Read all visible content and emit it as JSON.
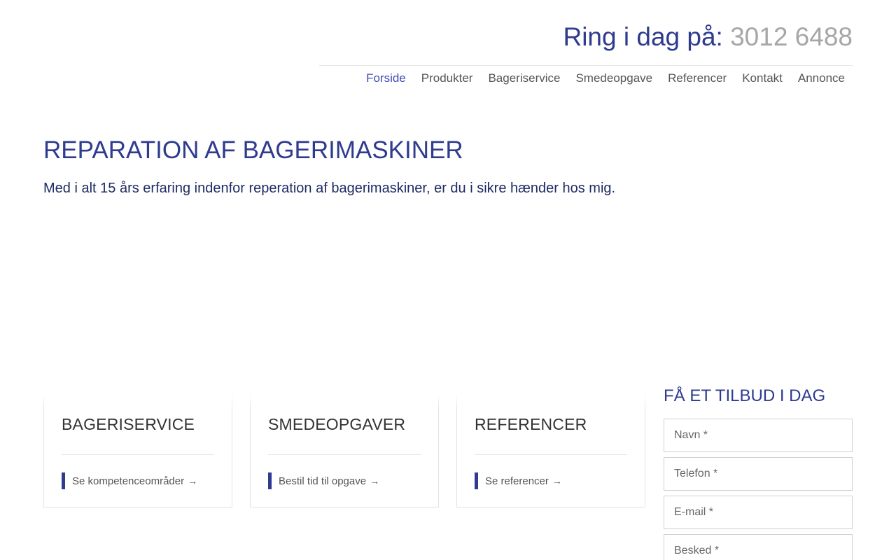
{
  "header": {
    "phone_label": "Ring i dag på:",
    "phone_number": "3012 6488"
  },
  "nav": {
    "items": [
      {
        "label": "Forside",
        "active": true
      },
      {
        "label": "Produkter",
        "active": false
      },
      {
        "label": "Bageriservice",
        "active": false
      },
      {
        "label": "Smedeopgave",
        "active": false
      },
      {
        "label": "Referencer",
        "active": false
      },
      {
        "label": "Kontakt",
        "active": false
      },
      {
        "label": "Annonce",
        "active": false
      }
    ]
  },
  "hero": {
    "title": "REPARATION AF BAGERIMASKINER",
    "subtitle": "Med i alt 15 års erfaring indenfor reperation af bagerimaskiner, er du i sikre hænder hos mig."
  },
  "cards": [
    {
      "title": "BAGERISERVICE",
      "link": "Se kompetenceområder",
      "arrow": "→"
    },
    {
      "title": "SMEDEOPGAVER",
      "link": "Bestil tid til opgave",
      "arrow": "→"
    },
    {
      "title": "REFERENCER",
      "link": "Se referencer",
      "arrow": "→"
    }
  ],
  "quote_form": {
    "title": "FÅ ET TILBUD I DAG",
    "name_placeholder": "Navn *",
    "phone_placeholder": "Telefon *",
    "email_placeholder": "E-mail *",
    "message_placeholder": "Besked *"
  },
  "colors": {
    "brand": "#2e3b8f",
    "nav_active": "#3d4db5",
    "phone_number": "#a6a6a6"
  }
}
